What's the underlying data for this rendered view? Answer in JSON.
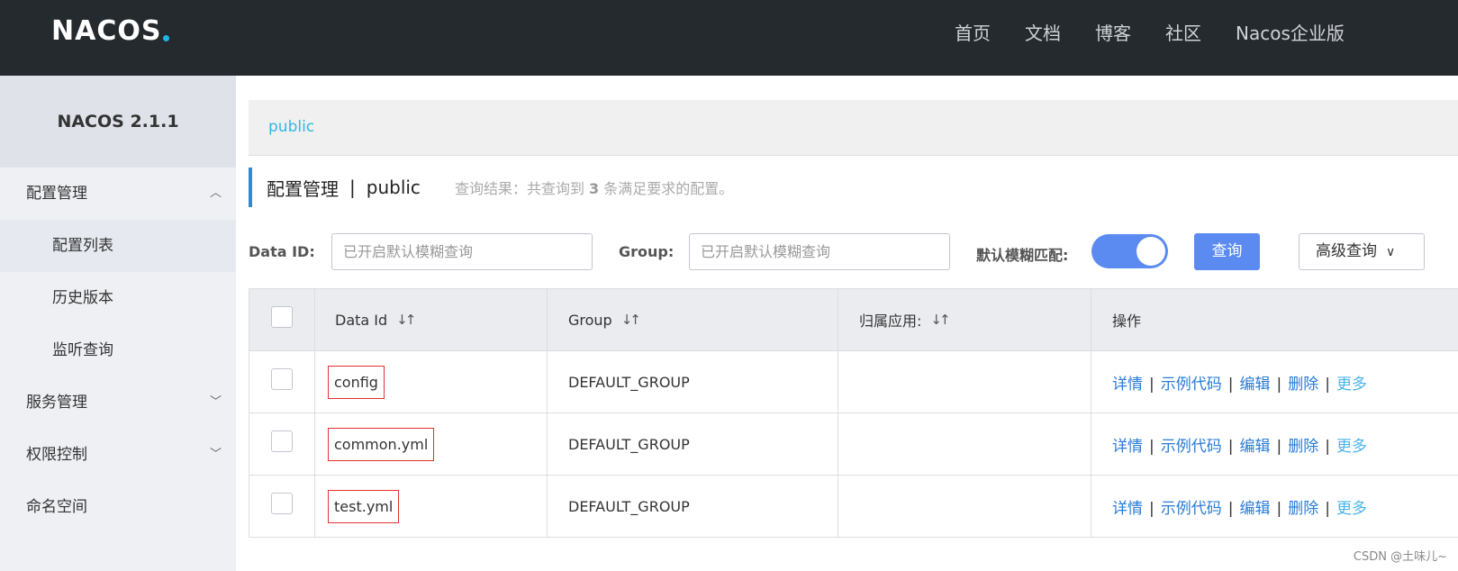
{
  "header": {
    "logo_text": "NACOS",
    "nav": [
      "首页",
      "文档",
      "博客",
      "社区",
      "Nacos企业版"
    ]
  },
  "sidebar": {
    "version": "NACOS 2.1.1",
    "config_group": "配置管理",
    "config_items": [
      "配置列表",
      "历史版本",
      "监听查询"
    ],
    "service_group": "服务管理",
    "auth_group": "权限控制",
    "namespace": "命名空间"
  },
  "main": {
    "namespace_link": "public",
    "title": "配置管理",
    "separator": "|",
    "title_ns": "public",
    "summary_prefix": "查询结果：共查询到",
    "summary_count": "3",
    "summary_suffix": "条满足要求的配置。",
    "search": {
      "dataid_label": "Data ID:",
      "dataid_placeholder": "已开启默认模糊查询",
      "group_label": "Group:",
      "group_placeholder": "已开启默认模糊查询",
      "fuzzy_label": "默认模糊匹配:",
      "query_button": "查询",
      "advanced_button": "高级查询"
    },
    "table": {
      "headers": [
        "Data Id",
        "Group",
        "归属应用:",
        "操作"
      ],
      "rows": [
        {
          "data_id": "config",
          "group": "DEFAULT_GROUP",
          "app": ""
        },
        {
          "data_id": "common.yml",
          "group": "DEFAULT_GROUP",
          "app": ""
        },
        {
          "data_id": "test.yml",
          "group": "DEFAULT_GROUP",
          "app": ""
        }
      ],
      "ops": [
        "详情",
        "示例代码",
        "编辑",
        "删除",
        "更多"
      ]
    }
  },
  "watermark": "CSDN @土味儿~"
}
